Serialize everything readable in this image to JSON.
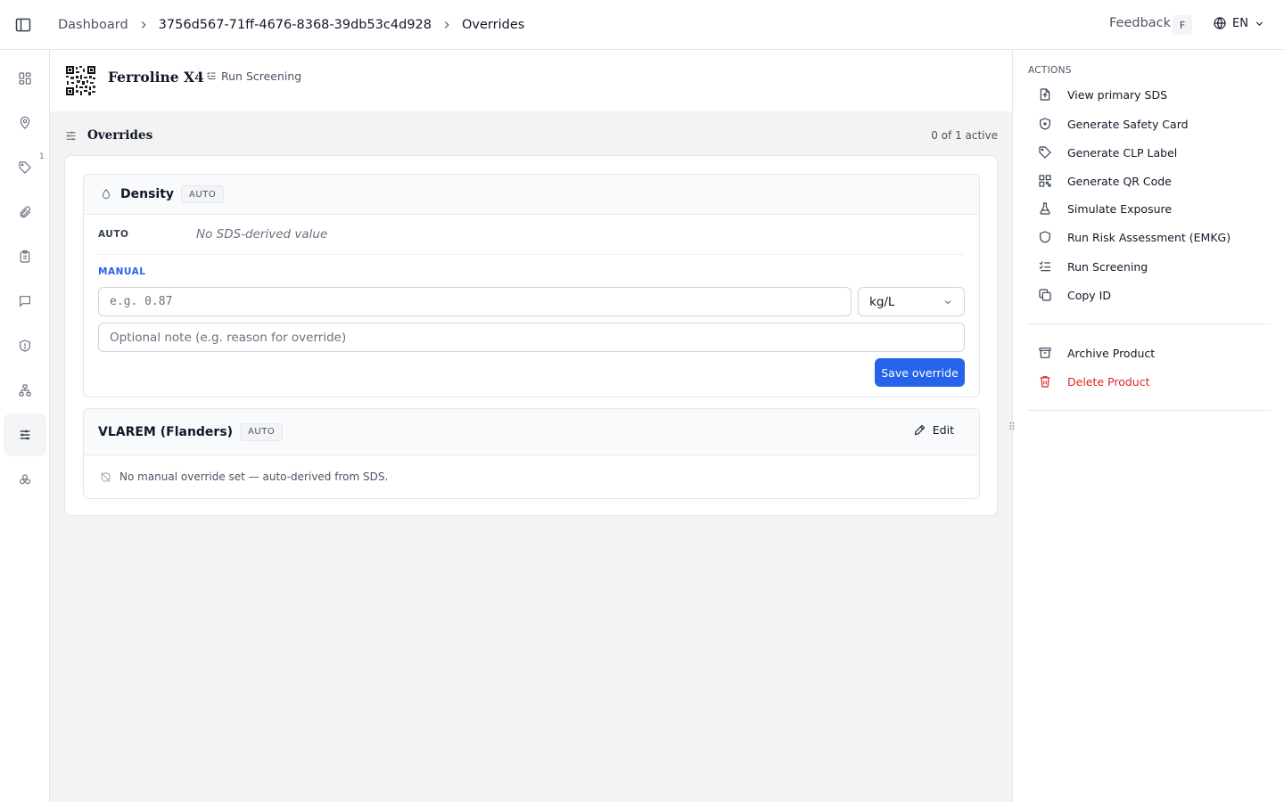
{
  "breadcrumb": {
    "items": [
      "Dashboard",
      "3756d567-71ff-4676-8368-39db53c4d928",
      "Overrides"
    ]
  },
  "topbar": {
    "feedback_label": "Feedback",
    "user_initial": "F",
    "language": "EN"
  },
  "rail": {
    "items": [
      "dashboard-icon",
      "location-icon",
      "tag-icon",
      "paperclip-icon",
      "clipboard-icon",
      "message-icon",
      "shield-icon",
      "hierarchy-icon",
      "sliders-icon",
      "components-icon"
    ],
    "active": "sliders-icon",
    "location_badge": "1"
  },
  "product": {
    "name": "Ferroline X4",
    "run_screening_label": "Run Screening"
  },
  "overrides": {
    "title": "Overrides",
    "count": "0 of 1 active"
  },
  "density": {
    "title": "Density",
    "badge": "AUTO",
    "auto_label": "AUTO",
    "auto_value": "No SDS-derived value",
    "manual_label": "MANUAL",
    "value_placeholder": "e.g. 0.87",
    "unit": "kg/L",
    "note_placeholder": "Optional note (e.g. reason for override)",
    "save_label": "Save override"
  },
  "vlarem": {
    "title": "VLAREM (Flanders)",
    "badge": "AUTO",
    "edit_label": "Edit",
    "message": "No manual override set — auto-derived from SDS."
  },
  "actions": {
    "heading": "ACTIONS",
    "items": [
      {
        "label": "View primary SDS",
        "icon": "file-upload-icon"
      },
      {
        "label": "Generate Safety Card",
        "icon": "shield-plus-icon"
      },
      {
        "label": "Generate CLP Label",
        "icon": "tag-icon"
      },
      {
        "label": "Generate QR Code",
        "icon": "qr-code-icon"
      },
      {
        "label": "Simulate Exposure",
        "icon": "flask-icon"
      },
      {
        "label": "Run Risk Assessment (EMKG)",
        "icon": "shield-icon"
      },
      {
        "label": "Run Screening",
        "icon": "list-checks-icon"
      },
      {
        "label": "Copy ID",
        "icon": "copy-icon"
      }
    ],
    "archive_label": "Archive Product",
    "delete_label": "Delete Product"
  },
  "colors": {
    "primary": "#2563eb",
    "danger": "#dc2626",
    "main_bg": "#f3f3f3"
  }
}
